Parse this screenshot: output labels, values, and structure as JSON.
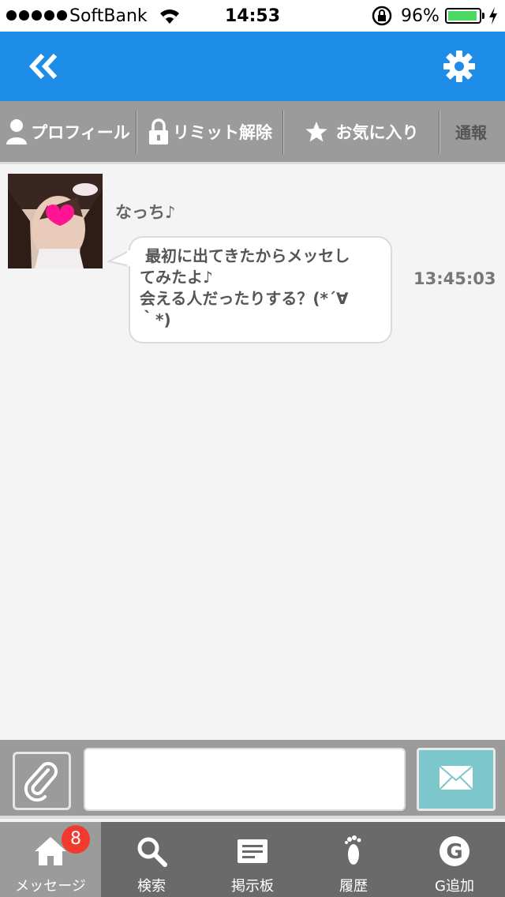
{
  "status_bar": {
    "carrier": "SoftBank",
    "time": "14:53",
    "battery_percent": "96%",
    "battery_level": 0.96,
    "signal_bars": 5,
    "icons": [
      "signal-dots-icon",
      "wifi-icon",
      "rotation-lock-icon",
      "battery-icon",
      "charging-bolt-icon"
    ]
  },
  "nav_bar": {
    "background": "#1e8de8",
    "back_icon": "double-chevron-left-icon",
    "settings_icon": "gear-icon"
  },
  "action_bar": {
    "profile_label": "プロフィール",
    "limit_release_label": "リミット解除",
    "favorite_label": "お気に入り",
    "report_label": "通報"
  },
  "chat": {
    "sender_name": "なっち♪",
    "message_line_1": " 最初に出てきたからメッセし",
    "message_line_2": "てみたよ♪",
    "message_line_3": "会える人だったりする？(*´∀",
    "message_line_4": "｀*)",
    "timestamp": "13:45:03"
  },
  "composer": {
    "input_value": "",
    "attach_icon": "paperclip-icon",
    "send_icon": "envelope-icon",
    "send_color": "#7cc7cb"
  },
  "tab_bar": {
    "tabs": [
      {
        "label": "メッセージ",
        "icon": "home-icon",
        "badge": "8",
        "active": true
      },
      {
        "label": "検索",
        "icon": "search-icon"
      },
      {
        "label": "掲示板",
        "icon": "board-icon"
      },
      {
        "label": "履歴",
        "icon": "footprint-icon"
      },
      {
        "label": "G追加",
        "icon": "g-circle-icon"
      }
    ]
  }
}
